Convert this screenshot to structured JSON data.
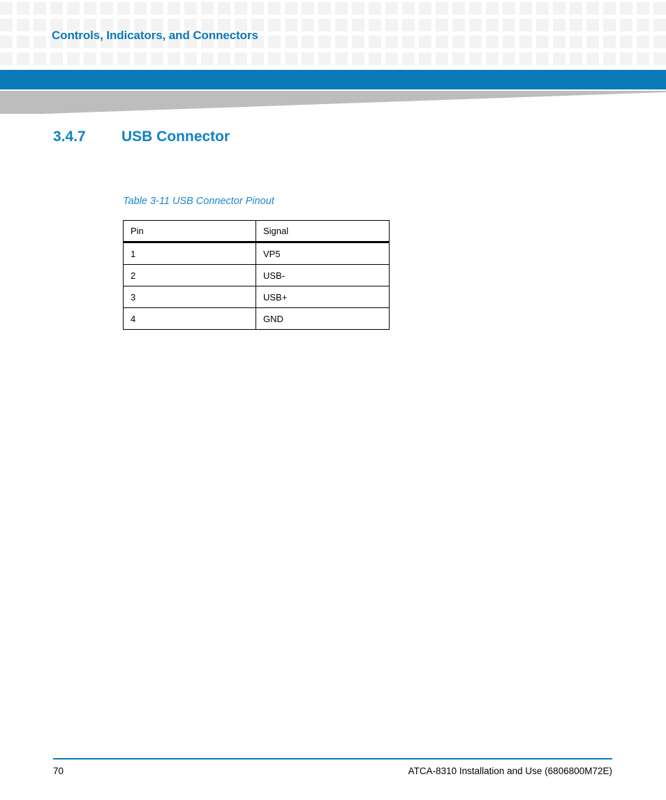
{
  "document": {
    "running_header": "Controls, Indicators, and Connectors",
    "accent_color": "#0b7ab8",
    "heading_color": "#1083c3",
    "caption_color": "#1b87c6"
  },
  "section": {
    "number": "3.4.7",
    "title": "USB Connector"
  },
  "table": {
    "caption": "Table 3-11 USB Connector Pinout",
    "columns": [
      "Pin",
      "Signal"
    ],
    "rows": [
      {
        "pin": "1",
        "signal": "VP5"
      },
      {
        "pin": "2",
        "signal": "USB-"
      },
      {
        "pin": "3",
        "signal": "USB+"
      },
      {
        "pin": "4",
        "signal": "GND"
      }
    ]
  },
  "footer": {
    "page_number": "70",
    "doc_title": "ATCA-8310 Installation and Use (6806800M72E)"
  }
}
